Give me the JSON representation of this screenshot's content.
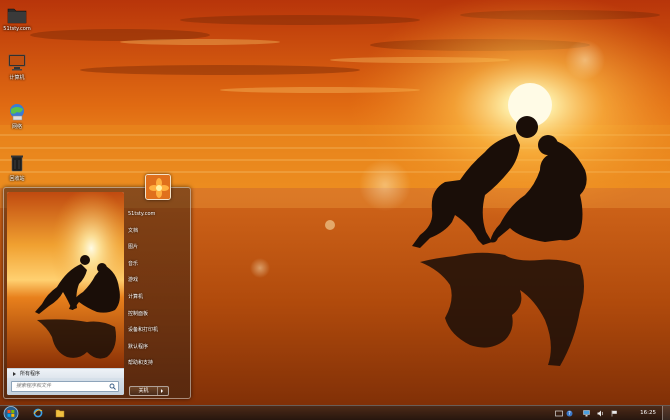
{
  "desktop": {
    "icons": [
      {
        "label": "51tsty.com",
        "icon": "folder-icon"
      },
      {
        "label": "计算机",
        "icon": "computer-icon"
      },
      {
        "label": "网络",
        "icon": "network-icon"
      },
      {
        "label": "回收站",
        "icon": "recycle-bin-icon"
      }
    ]
  },
  "start_menu": {
    "all_programs": "所有程序",
    "search_placeholder": "搜索程序和文件",
    "right_items": [
      {
        "label": "51tsty.com"
      },
      {
        "label": "文档"
      },
      {
        "label": "图片"
      },
      {
        "label": "音乐"
      },
      {
        "label": "游戏"
      },
      {
        "label": "计算机"
      },
      {
        "label": "控制面板"
      },
      {
        "label": "设备和打印机"
      },
      {
        "label": "默认程序"
      },
      {
        "label": "帮助和支持"
      }
    ],
    "shutdown_label": "关机"
  },
  "taskbar": {
    "pinned": [
      "ie-icon",
      "explorer-icon",
      "media-player-icon"
    ],
    "tray_icons": [
      "keyboard-icon",
      "help-icon",
      "network-icon",
      "volume-icon",
      "flag-icon"
    ],
    "clock": "16:25"
  },
  "colors": {
    "sky_top": "#c0420c",
    "sun": "#fff4c0",
    "sea": "#e07a18",
    "sand": "#9a3c08",
    "silhouette": "#1a0e08"
  }
}
